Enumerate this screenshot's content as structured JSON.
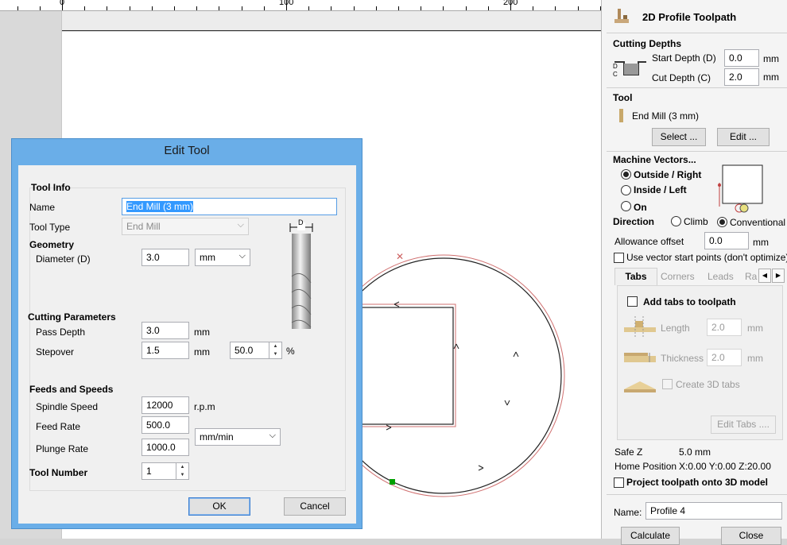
{
  "ruler": {
    "labels": [
      "0",
      "100",
      "200"
    ]
  },
  "dialog": {
    "title": "Edit Tool",
    "tool_info_heading": "Tool Info",
    "name_label": "Name",
    "name_value": "End Mill (3 mm)",
    "tool_type_label": "Tool Type",
    "tool_type_value": "End Mill",
    "geometry_heading": "Geometry",
    "diameter_label": "Diameter (D)",
    "diameter_value": "3.0",
    "diameter_units": "mm",
    "diagram_label": "D",
    "cutting_params_heading": "Cutting Parameters",
    "pass_depth_label": "Pass Depth",
    "pass_depth_value": "3.0",
    "pass_depth_units": "mm",
    "stepover_label": "Stepover",
    "stepover_value": "1.5",
    "stepover_units": "mm",
    "stepover_percent": "50.0",
    "percent_sign": "%",
    "feeds_heading": "Feeds and Speeds",
    "spindle_label": "Spindle Speed",
    "spindle_value": "12000",
    "spindle_units": "r.p.m",
    "feed_label": "Feed Rate",
    "feed_value": "500.0",
    "plunge_label": "Plunge Rate",
    "plunge_value": "1000.0",
    "rate_units": "mm/min",
    "tool_number_label": "Tool Number",
    "tool_number_value": "1",
    "ok_label": "OK",
    "cancel_label": "Cancel"
  },
  "panel": {
    "title": "2D Profile Toolpath",
    "cutting_depths_heading": "Cutting Depths",
    "start_depth_label": "Start Depth (D)",
    "start_depth_value": "0.0",
    "cut_depth_label": "Cut Depth (C)",
    "cut_depth_value": "2.0",
    "units": "mm",
    "tool_heading": "Tool",
    "tool_name": "End Mill (3 mm)",
    "select_label": "Select ...",
    "edit_label": "Edit ...",
    "machine_vectors_heading": "Machine Vectors...",
    "outside_label": "Outside / Right",
    "inside_label": "Inside / Left",
    "on_label": "On",
    "direction_label": "Direction",
    "climb_label": "Climb",
    "conventional_label": "Conventional",
    "allowance_label": "Allowance offset",
    "allowance_value": "0.0",
    "vector_start_label": "Use vector start points (don't optimize)",
    "tabs": [
      "Tabs",
      "Corners",
      "Leads",
      "Ra"
    ],
    "add_tabs_label": "Add tabs to toolpath",
    "length_label": "Length",
    "length_value": "2.0",
    "thickness_label": "Thickness",
    "thickness_value": "2.0",
    "create_3d_tabs_label": "Create 3D tabs",
    "edit_tabs_label": "Edit Tabs ....",
    "safe_z_label": "Safe Z",
    "safe_z_value": "5.0 mm",
    "home_label": "Home Position",
    "home_value": "X:0.00 Y:0.00 Z:20.00",
    "project_label": "Project toolpath onto 3D model",
    "name_label": "Name:",
    "name_value": "Profile 4",
    "calculate_label": "Calculate",
    "close_label": "Close"
  },
  "colors": {
    "dialog_frame": "#6aaee8",
    "selection": "#3399ff",
    "start_point": "#00a000"
  }
}
